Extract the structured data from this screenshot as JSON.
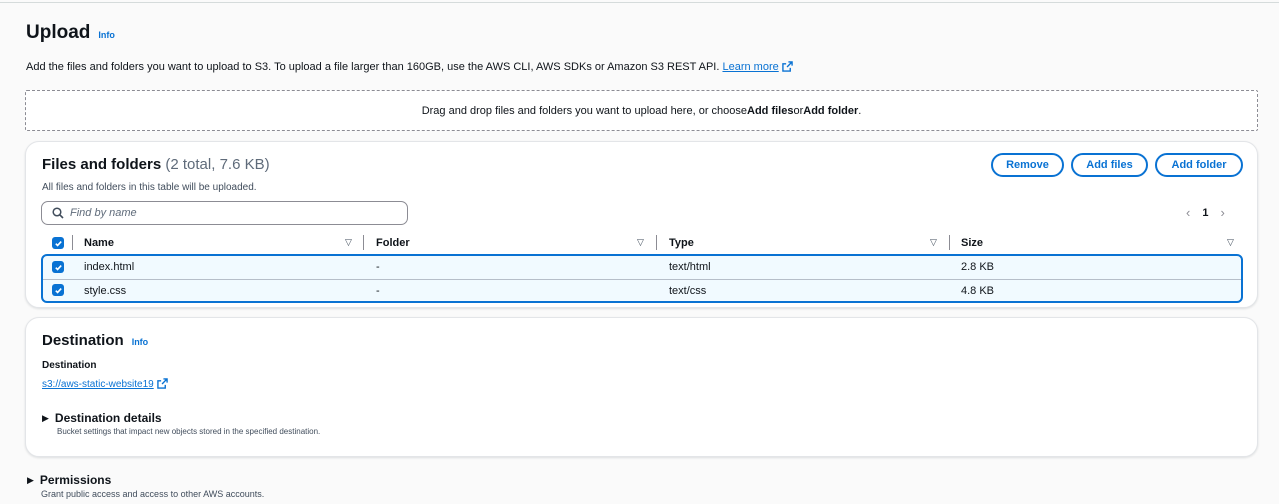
{
  "header": {
    "title": "Upload",
    "info_label": "Info",
    "description": "Add the files and folders you want to upload to S3. To upload a file larger than 160GB, use the AWS CLI, AWS SDKs or Amazon S3 REST API.",
    "learn_more": "Learn more"
  },
  "dropzone": {
    "text_before": "Drag and drop files and folders you want to upload here, or choose ",
    "add_files": "Add files",
    "or": " or ",
    "add_folder": "Add folder",
    "end": "."
  },
  "files": {
    "title": "Files and folders",
    "count": "(2 total, 7.6 KB)",
    "subtitle": "All files and folders in this table will be uploaded.",
    "buttons": {
      "remove": "Remove",
      "add_files": "Add files",
      "add_folder": "Add folder"
    },
    "search_placeholder": "Find by name",
    "page": "1",
    "columns": {
      "name": "Name",
      "folder": "Folder",
      "type": "Type",
      "size": "Size"
    },
    "rows": [
      {
        "name": "index.html",
        "folder": "-",
        "type": "text/html",
        "size": "2.8 KB",
        "checked": true
      },
      {
        "name": "style.css",
        "folder": "-",
        "type": "text/css",
        "size": "4.8 KB",
        "checked": true
      }
    ]
  },
  "destination": {
    "title": "Destination",
    "info_label": "Info",
    "label": "Destination",
    "bucket": "s3://aws-static-website19",
    "details_title": "Destination details",
    "details_sub": "Bucket settings that impact new objects stored in the specified destination."
  },
  "permissions": {
    "title": "Permissions",
    "sub": "Grant public access and access to other AWS accounts."
  },
  "colors": {
    "accent": "#0972d3",
    "selected_row_bg": "#f1faff",
    "text": "#0f141a"
  }
}
